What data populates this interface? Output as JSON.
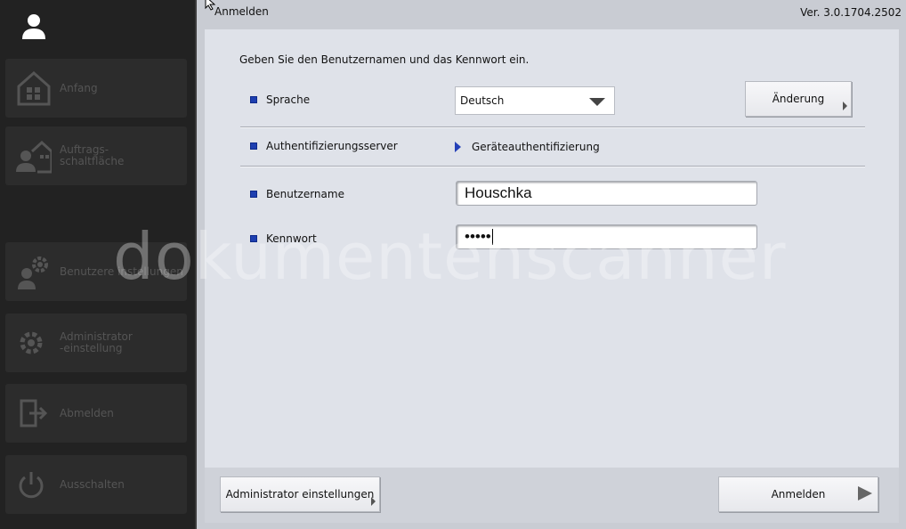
{
  "sidebar": {
    "user_icon": "user-icon",
    "items": [
      {
        "label": "Anfang",
        "icon": "home-icon"
      },
      {
        "label": "Auftrags-\nschaltfläche",
        "icon": "job-button-icon"
      },
      {
        "label": "Benutzere instellungen",
        "icon": "user-settings-icon"
      },
      {
        "label": "Administrator\n-einstellung",
        "icon": "gear-icon"
      },
      {
        "label": "Abmelden",
        "icon": "logout-icon"
      },
      {
        "label": "Ausschalten",
        "icon": "power-icon"
      }
    ]
  },
  "header": {
    "title": "Anmelden",
    "version": "Ver. 3.0.1704.2502"
  },
  "form": {
    "instruction": "Geben Sie den Benutzernamen und das Kennwort ein.",
    "language_label": "Sprache",
    "language_value": "Deutsch",
    "change_button": "Änderung",
    "auth_server_label": "Authentifizierungsserver",
    "auth_server_value": "Geräteauthentifizierung",
    "username_label": "Benutzername",
    "username_value": "Houschka",
    "password_label": "Kennwort",
    "password_value": "•••••"
  },
  "footer": {
    "admin_button": "Administrator einstellungen",
    "login_button": "Anmelden"
  },
  "watermark": "dokumentenscanner",
  "colors": {
    "sidebar_bg": "#222222",
    "panel_bg": "#dfe2e9",
    "bullet": "#1e3fb0"
  }
}
